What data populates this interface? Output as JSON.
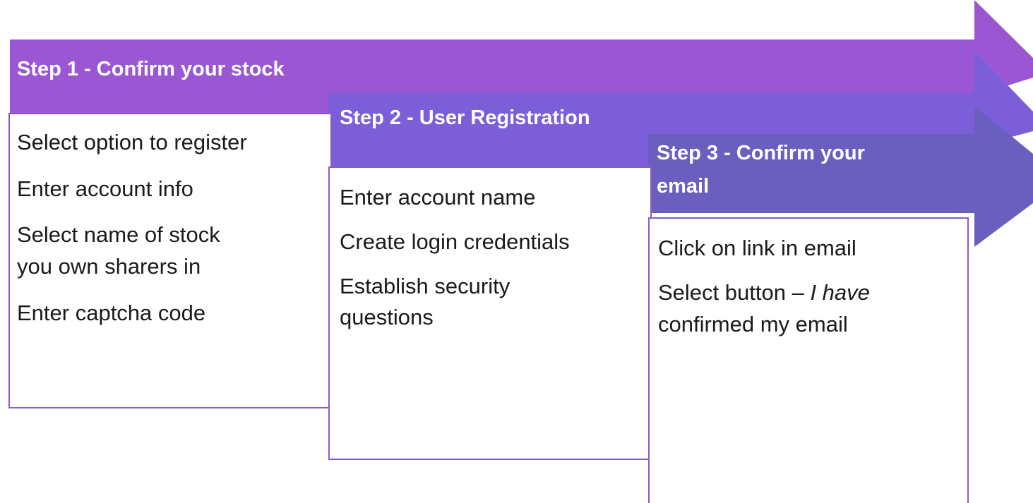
{
  "colors": {
    "step1": "#9b57d3",
    "step2": "#7b5ed8",
    "step3": "#6a5fbf",
    "box_border": "#8a5bc4"
  },
  "steps": [
    {
      "title": "Step 1 - Confirm your stock",
      "items": [
        "Select option to register",
        "Enter account info",
        "Select name of stock",
        "you own sharers in",
        "Enter captcha code"
      ]
    },
    {
      "title": "Step 2 - User Registration",
      "items": [
        "Enter account name",
        "Create  login credentials",
        "Establish security",
        "questions"
      ]
    },
    {
      "title_line1": "Step 3 - Confirm your",
      "title_line2": "email",
      "item1": "Click on link in email",
      "item2_plain": "Select button – ",
      "item2_italic": "I have",
      "item3_italic": "confirmed my email"
    }
  ]
}
